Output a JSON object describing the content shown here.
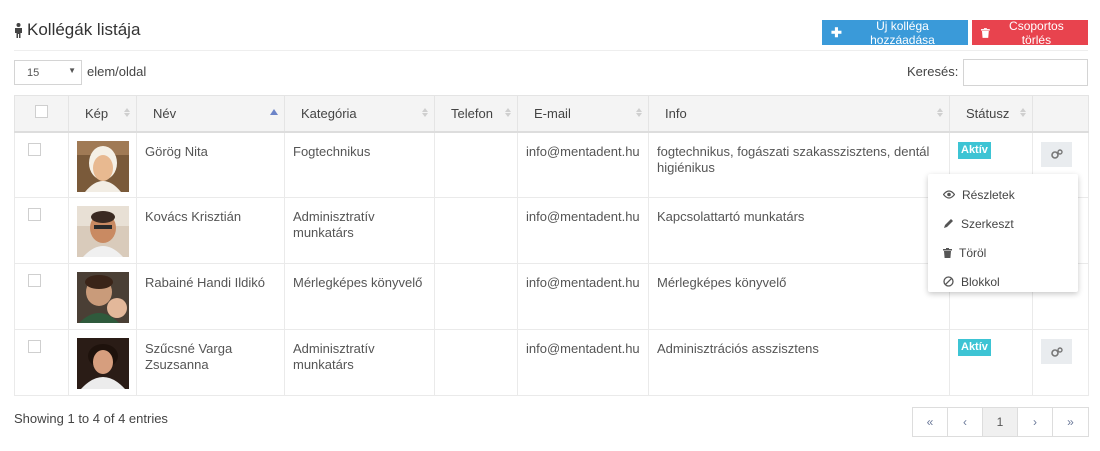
{
  "header": {
    "title": "Kollégák listája",
    "add_button": "Új kolléga hozzáadása",
    "delete_button": "Csoportos törlés"
  },
  "controls": {
    "page_size": "15",
    "per_page_label": "elem/oldal",
    "search_label": "Keresés:",
    "search_value": ""
  },
  "table": {
    "columns": [
      "Kép",
      "Név",
      "Kategória",
      "Telefon",
      "E-mail",
      "Info",
      "Státusz"
    ],
    "rows": [
      {
        "name": "Görög Nita",
        "category": "Fogtechnikus",
        "phone": "",
        "email": "info@mentadent.hu",
        "info": "fogtechnikus, fogászati szakasszisztens, dentál higiénikus",
        "status": "Aktív"
      },
      {
        "name": "Kovács Krisztián",
        "category": "Adminisztratív munkatárs",
        "phone": "",
        "email": "info@mentadent.hu",
        "info": "Kapcsolattartó munkatárs",
        "status": ""
      },
      {
        "name": "Rabainé Handi Ildikó",
        "category": "Mérlegképes könyvelő",
        "phone": "",
        "email": "info@mentadent.hu",
        "info": "Mérlegképes könyvelő",
        "status": ""
      },
      {
        "name": "Szűcsné Varga Zsuzsanna",
        "category": "Adminisztratív munkatárs",
        "phone": "",
        "email": "info@mentadent.hu",
        "info": "Adminisztrációs asszisztens",
        "status": "Aktív"
      }
    ]
  },
  "menu": {
    "items": [
      "Részletek",
      "Szerkeszt",
      "Töröl",
      "Blokkol"
    ]
  },
  "footer": {
    "showing": "Showing 1 to 4 of 4 entries",
    "pager": [
      "«",
      "‹",
      "1",
      "›",
      "»"
    ]
  },
  "colors": {
    "primary": "#3a9ad9",
    "danger": "#e8434e",
    "badge": "#3dc4d4"
  }
}
